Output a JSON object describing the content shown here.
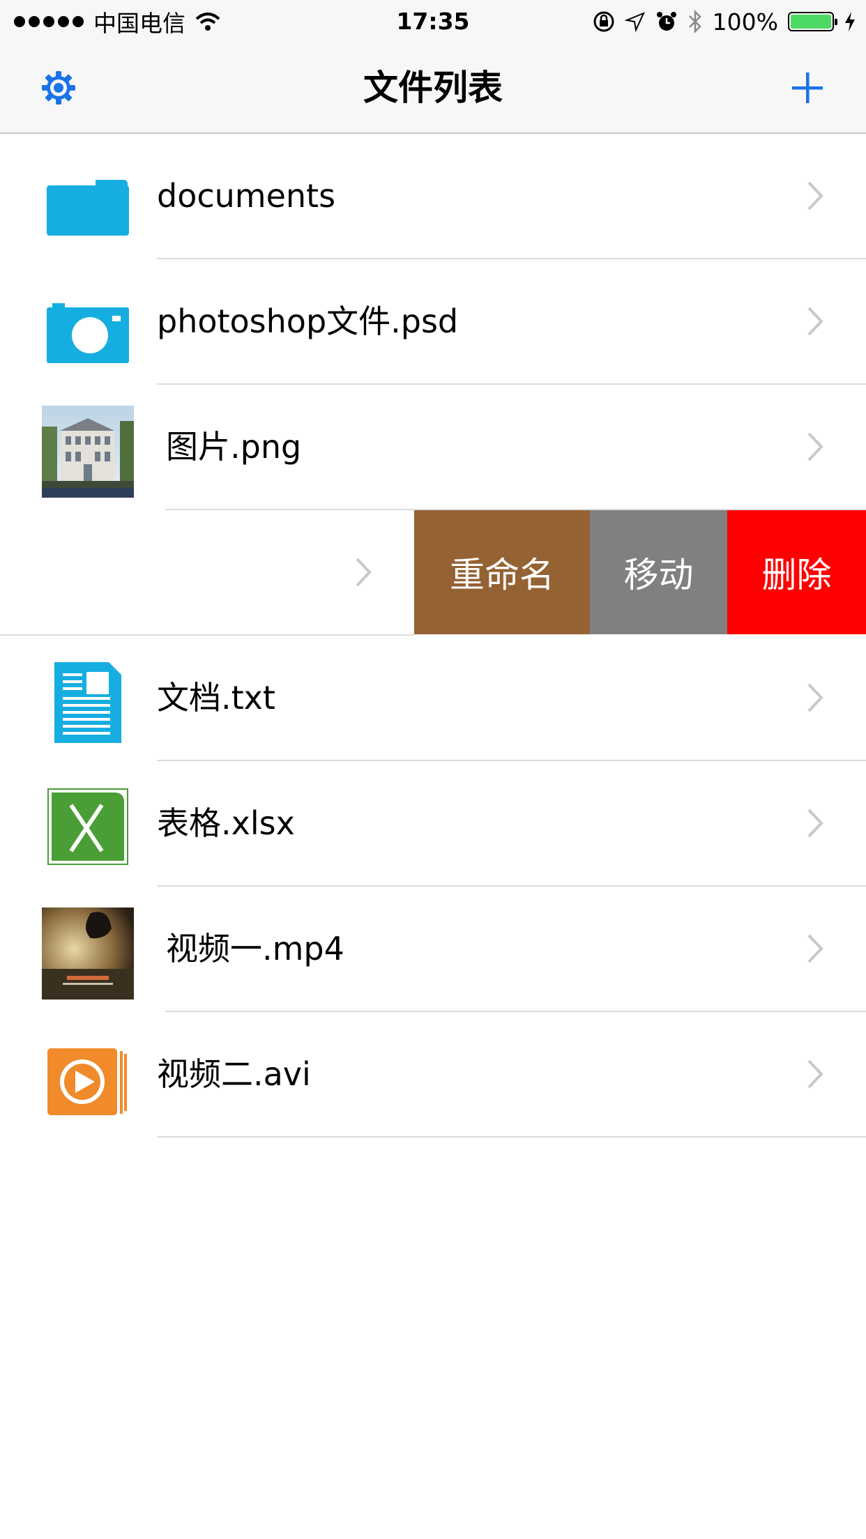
{
  "status_bar": {
    "carrier": "中国电信",
    "time": "17:35",
    "battery_percent": "100%",
    "battery_level": 1.0,
    "icons": [
      "signal-dots-icon",
      "wifi-icon",
      "orientation-lock-icon",
      "location-icon",
      "alarm-icon",
      "bluetooth-icon",
      "battery-icon",
      "charging-icon"
    ]
  },
  "nav": {
    "title": "文件列表",
    "left_icon": "gear-icon",
    "right_icon": "plus-icon",
    "accent_color": "#1a73e8"
  },
  "files": [
    {
      "name": "documents",
      "icon": "folder-icon"
    },
    {
      "name": "photoshop文件.psd",
      "icon": "camera-icon"
    },
    {
      "name": "图片.png",
      "icon": "image-thumbnail"
    },
    {
      "name": "",
      "icon": ""
    },
    {
      "name": "文档.txt",
      "icon": "document-icon"
    },
    {
      "name": "表格.xlsx",
      "icon": "excel-icon"
    },
    {
      "name": "视频一.mp4",
      "icon": "video-thumbnail"
    },
    {
      "name": "视频二.avi",
      "icon": "play-icon"
    }
  ],
  "swipe_actions": {
    "rename": "重命名",
    "move": "移动",
    "delete": "删除",
    "colors": {
      "rename": "#956233",
      "move": "#808080",
      "delete": "#ff0000"
    }
  }
}
